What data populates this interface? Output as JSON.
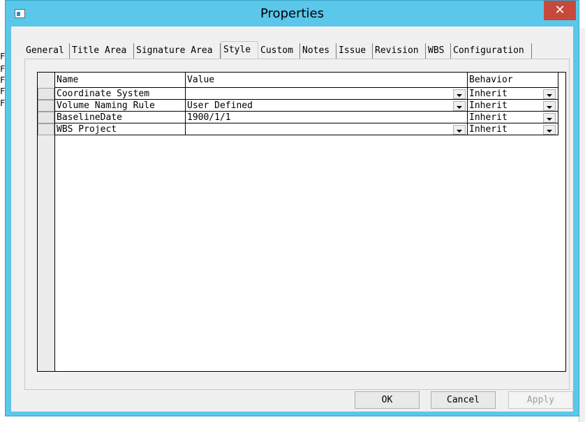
{
  "window": {
    "title": "Properties"
  },
  "background_fragments": [
    "F",
    "F",
    "F",
    "F",
    "F"
  ],
  "tabs": [
    {
      "label": "General"
    },
    {
      "label": "Title Area"
    },
    {
      "label": "Signature Area"
    },
    {
      "label": "Style",
      "active": true
    },
    {
      "label": "Custom"
    },
    {
      "label": "Notes"
    },
    {
      "label": "Issue"
    },
    {
      "label": "Revision"
    },
    {
      "label": "WBS"
    },
    {
      "label": "Configuration"
    }
  ],
  "grid": {
    "columns": [
      "Name",
      "Value",
      "Behavior"
    ],
    "rows": [
      {
        "name": "Coordinate System",
        "value": "",
        "behavior": "Inherit",
        "value_dropdown": true
      },
      {
        "name": "Volume Naming Rule",
        "value": "User Defined",
        "behavior": "Inherit",
        "value_dropdown": true
      },
      {
        "name": "BaselineDate",
        "value": "1900/1/1",
        "behavior": "Inherit",
        "value_dropdown": false
      },
      {
        "name": "WBS Project",
        "value": "",
        "behavior": "Inherit",
        "value_dropdown": true
      }
    ]
  },
  "buttons": {
    "ok": "OK",
    "cancel": "Cancel",
    "apply": "Apply"
  }
}
